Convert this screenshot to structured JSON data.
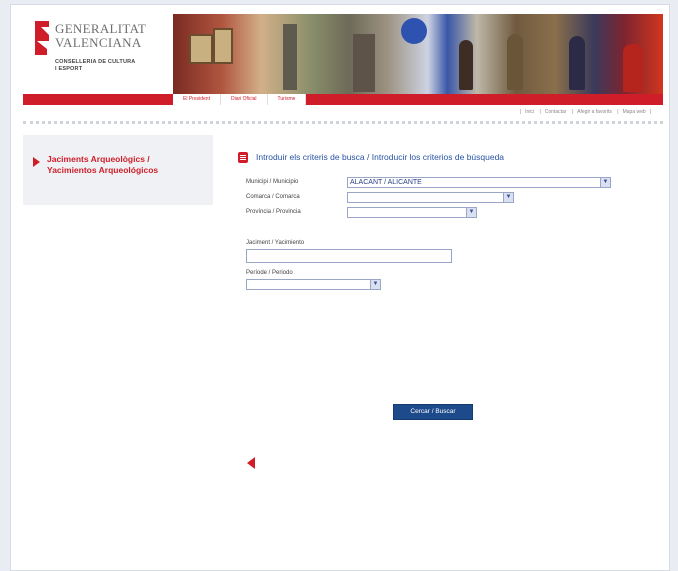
{
  "header": {
    "logo_line1": "GENERALITAT",
    "logo_line2": "VALENCIANA",
    "logo_sub1": "CONSELLERIA DE CULTURA",
    "logo_sub2": "I ESPORT",
    "nav": [
      "El President",
      "Diari Oficial",
      "Turisme"
    ],
    "utility": [
      "Inici",
      "Contactar",
      "Afegir a favorits",
      "Mapa web"
    ]
  },
  "sidebar": {
    "link": "Jaciments Arqueològics / Yacimientos Arqueológicos"
  },
  "form": {
    "title": "Introduir els criteris de busca / Introducir los criterios de búsqueda",
    "municipio_label": "Municipi / Municipio",
    "municipio_value": "ALACANT / ALICANTE",
    "comarca_label": "Comarca / Comarca",
    "comarca_value": "",
    "provincia_label": "Província / Provincia",
    "provincia_value": "",
    "jaciment_label": "Jaciment / Yacimiento",
    "jaciment_value": "",
    "periode_label": "Període / Periodo",
    "periode_value": "",
    "search_button": "Cercar / Buscar"
  },
  "colors": {
    "brand_red": "#cf1d2a",
    "link_blue": "#2753a3",
    "button_blue": "#1c4a8a"
  }
}
